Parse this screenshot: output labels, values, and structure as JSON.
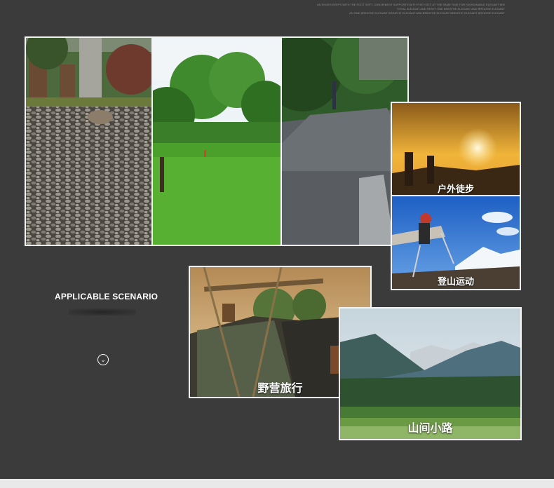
{
  "header": {
    "fine_print": [
      "AN SHOES KEEPS WITH THE FOOT SOFT, CONVENIENT SUPPORTS WITH THE FOOT, AT THE SAME TIME FOR FASHIONABLE ELEGANT BREATHE EXP",
      "STEAL ELEGANT AND HEAVY ONE BREATHE ELEGANT AND BREATHE ELEGANT",
      "AN ONE BREATHE ELEGANT BREATHE ELEGANT AND BREATHE ELEGANT BREATHE ELEGANT BREATHE ELEGANT"
    ]
  },
  "section": {
    "title": "APPLICABLE SCENARIO",
    "scroll_icon": "chevron-down-circle-icon"
  },
  "scenes": {
    "hiking": "户外徒步",
    "mountaineering": "登山运动",
    "camping": "野营旅行",
    "mountain_road": "山间小路"
  },
  "colors": {
    "background": "#3b3b3b",
    "frame": "#f4f4f4",
    "caption": "#ffffff"
  }
}
